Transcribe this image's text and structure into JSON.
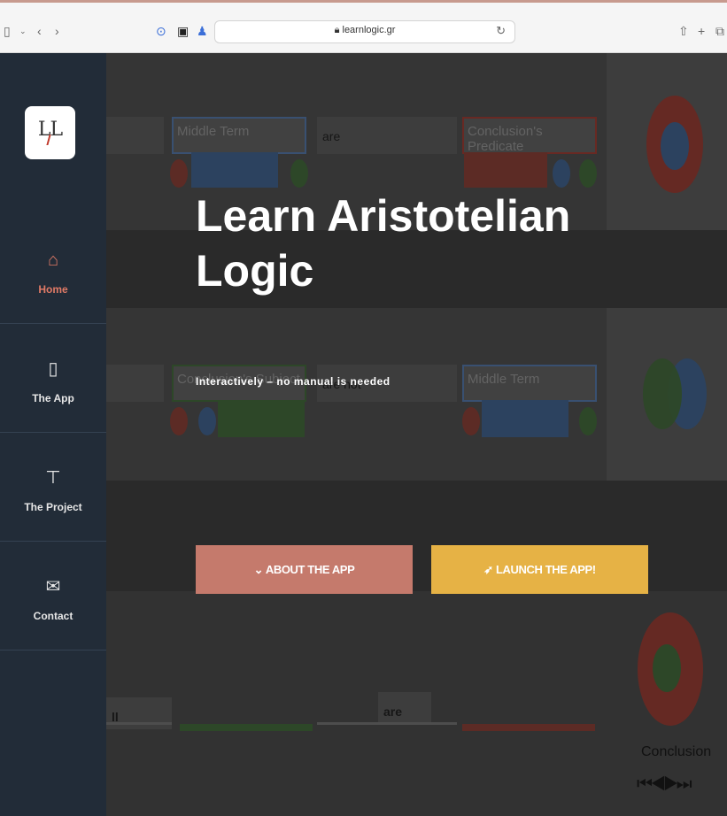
{
  "browser": {
    "url": "learnlogic.gr",
    "icons": [
      "sidebar-toggle-icon",
      "chevron-down-icon",
      "back-icon",
      "forward-icon",
      "play-circle-icon",
      "extension-icon",
      "extension-person-icon",
      "lock-icon",
      "reload-icon",
      "share-icon",
      "new-tab-icon",
      "tabs-icon"
    ]
  },
  "sidebar": {
    "logo": "LL",
    "items": [
      {
        "label": "Home",
        "icon": "home-icon",
        "active": true
      },
      {
        "label": "The App",
        "icon": "phone-icon",
        "active": false
      },
      {
        "label": "The Project",
        "icon": "flowchart-icon",
        "active": false
      },
      {
        "label": "Contact",
        "icon": "mail-icon",
        "active": false
      }
    ]
  },
  "background": {
    "row1": {
      "middle_term": "Middle Term",
      "verb": "are",
      "conclusion_predicate": "Conclusion's Predicate"
    },
    "row2": {
      "conclusion_subject": "Conclusion's Subject",
      "verb": "are not",
      "middle_term": "Middle Term"
    },
    "row3": {
      "first": "ll",
      "verb": "are"
    },
    "conclusion_label": "Conclusion",
    "media_controls": "⏮◀▶⏭"
  },
  "hero": {
    "title": "Learn Aristotelian Logic",
    "subtitle": "Interactively – no manual is needed",
    "about_button": "ABOUT THE APP",
    "launch_button": "LAUNCH THE APP!"
  },
  "colors": {
    "sidebar": "#222c38",
    "accent": "#e07a66",
    "about": "#c57a6c",
    "launch": "#e6b245"
  }
}
